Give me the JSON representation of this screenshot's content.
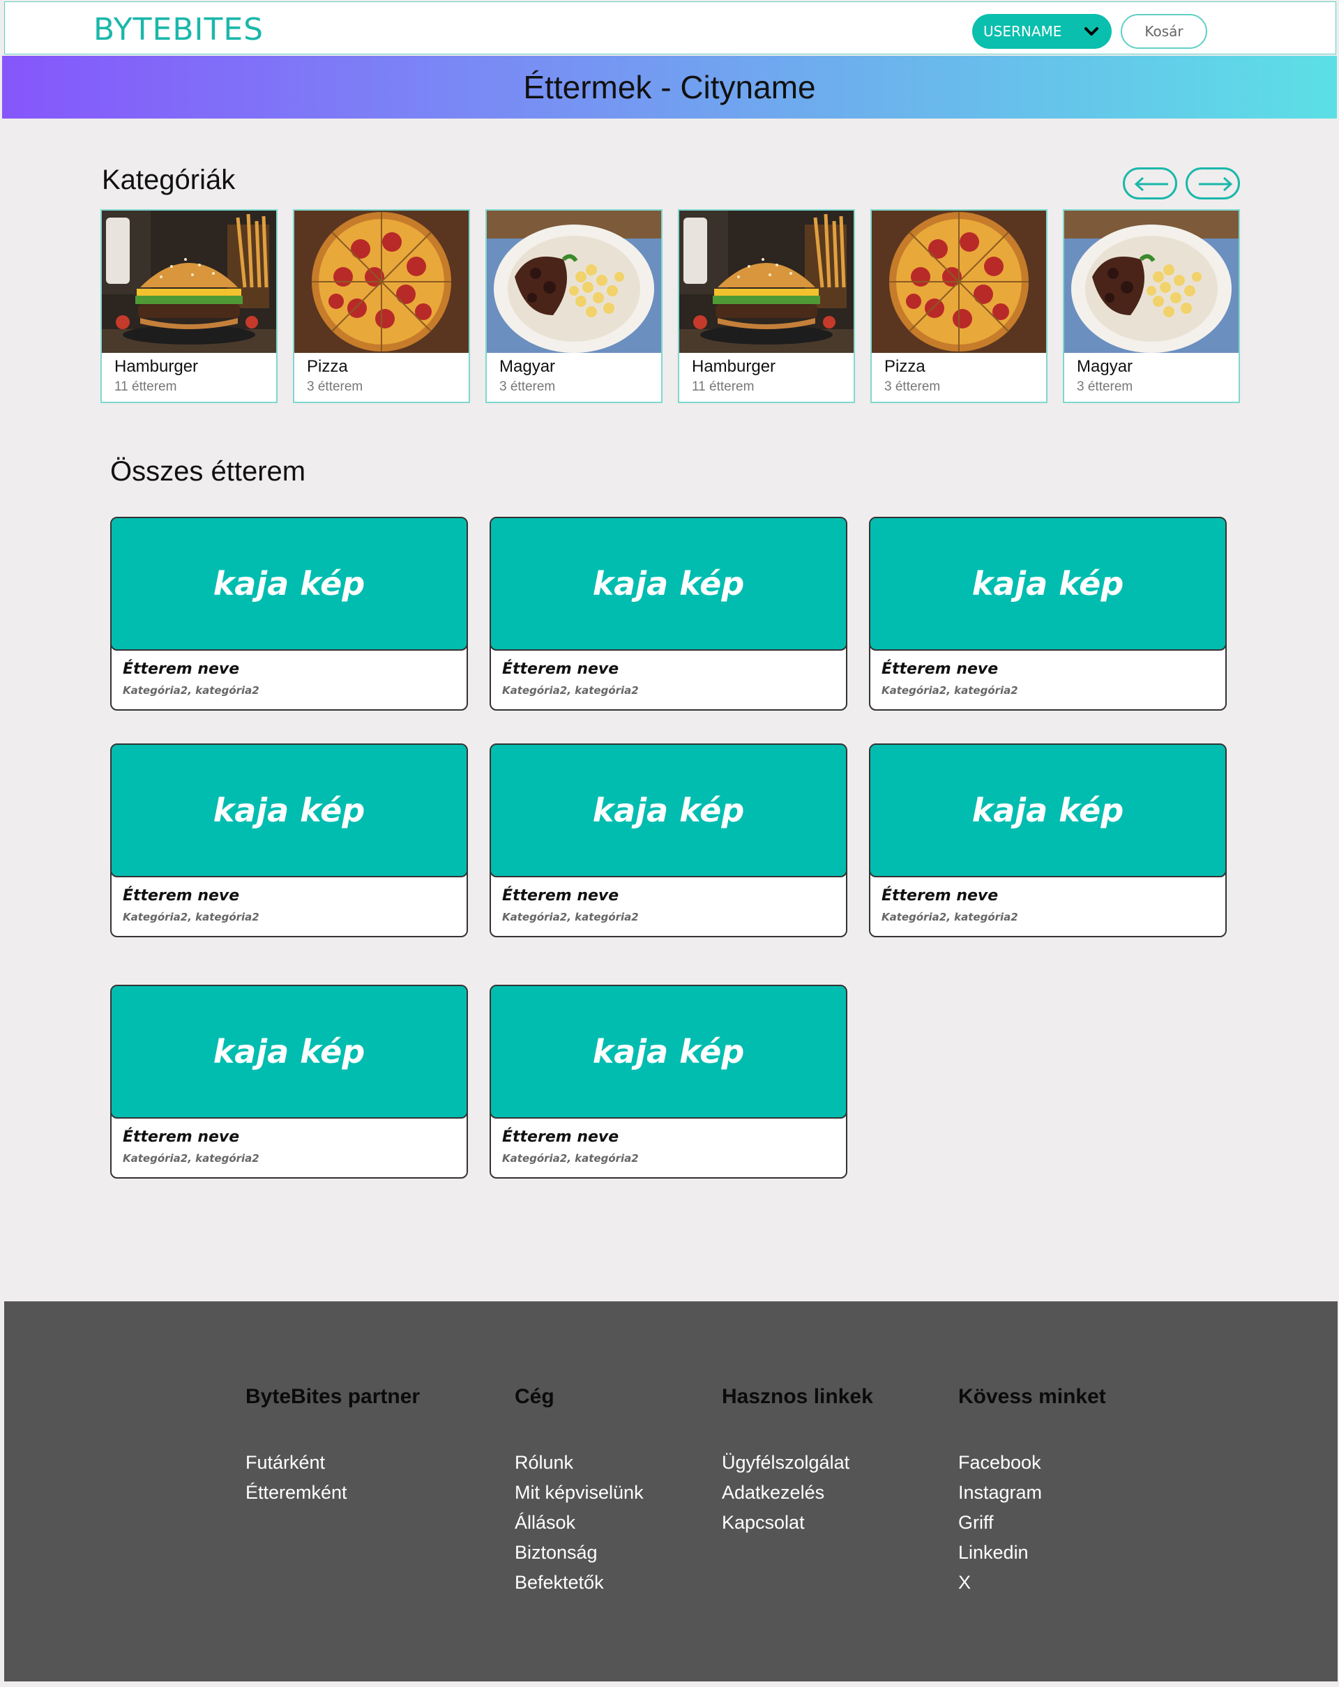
{
  "header": {
    "logo": "BYTEBITES",
    "username": "USERNAME",
    "cart": "Kosár"
  },
  "hero": {
    "title": "Éttermek - Cityname"
  },
  "categories": {
    "title": "Kategóriák",
    "items": [
      {
        "name": "Hamburger",
        "count": "11 étterem",
        "image": "burger"
      },
      {
        "name": "Pizza",
        "count": "3 étterem",
        "image": "pizza"
      },
      {
        "name": "Magyar",
        "count": "3 étterem",
        "image": "magyar"
      },
      {
        "name": "Hamburger",
        "count": "11 étterem",
        "image": "burger"
      },
      {
        "name": "Pizza",
        "count": "3 étterem",
        "image": "pizza"
      },
      {
        "name": "Magyar",
        "count": "3 étterem",
        "image": "magyar"
      }
    ]
  },
  "restaurants": {
    "title": "Összes étterem",
    "items": [
      {
        "image_label": "kaja kép",
        "name": "Étterem neve",
        "categories": "Kategória2, kategória2"
      },
      {
        "image_label": "kaja kép",
        "name": "Étterem neve",
        "categories": "Kategória2, kategória2"
      },
      {
        "image_label": "kaja kép",
        "name": "Étterem neve",
        "categories": "Kategória2, kategória2"
      },
      {
        "image_label": "kaja kép",
        "name": "Étterem neve",
        "categories": "Kategória2, kategória2"
      },
      {
        "image_label": "kaja kép",
        "name": "Étterem neve",
        "categories": "Kategória2, kategória2"
      },
      {
        "image_label": "kaja kép",
        "name": "Étterem neve",
        "categories": "Kategória2, kategória2"
      },
      {
        "image_label": "kaja kép",
        "name": "Étterem neve",
        "categories": "Kategória2, kategória2"
      },
      {
        "image_label": "kaja kép",
        "name": "Étterem neve",
        "categories": "Kategória2, kategória2"
      }
    ]
  },
  "footer": {
    "columns": [
      {
        "title": "ByteBites partner",
        "links": [
          "Futárként",
          "Étteremként"
        ]
      },
      {
        "title": "Cég",
        "links": [
          "Rólunk",
          "Mit képviselünk",
          "Állások",
          "Biztonság",
          "Befektetők"
        ]
      },
      {
        "title": "Hasznos linkek",
        "links": [
          "Ügyfélszolgálat",
          "Adatkezelés",
          "Kapcsolat"
        ]
      },
      {
        "title": "Kövess minket",
        "links": [
          "Facebook",
          "Instagram",
          "Griff",
          "Linkedin",
          "X"
        ]
      }
    ]
  },
  "colors": {
    "accent": "#0abfad",
    "card_image": "#00bdb0",
    "footer_bg": "#555555",
    "page_bg": "#efeded"
  }
}
